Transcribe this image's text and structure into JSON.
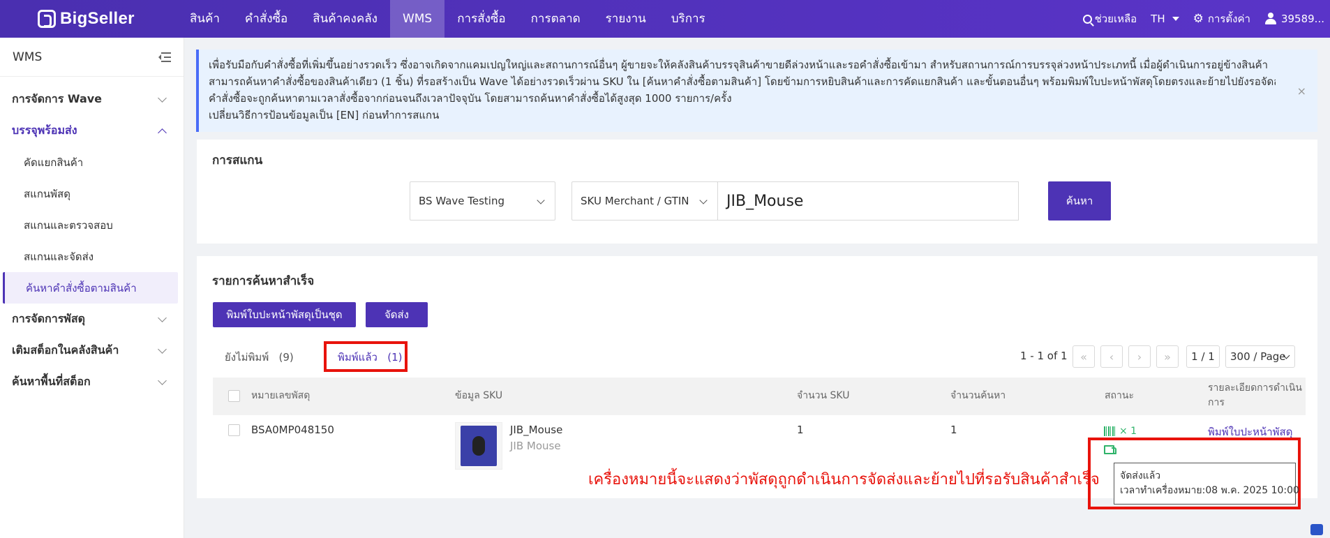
{
  "topnav": {
    "logo": "BigSeller",
    "items": [
      "สินค้า",
      "คำสั่งซื้อ",
      "สินค้าคงคลัง",
      "WMS",
      "การสั่งซื้อ",
      "การตลาด",
      "รายงาน",
      "บริการ"
    ],
    "active_index": 3,
    "help": "ช่วยเหลือ",
    "lang": "TH",
    "settings": "การตั้งค่า",
    "user": "39589..."
  },
  "sidebar": {
    "title": "WMS",
    "groups": [
      {
        "label": "การจัดการ Wave",
        "open": false
      },
      {
        "label": "บรรจุพร้อมส่ง",
        "open": true
      },
      {
        "label": "การจัดการพัสดุ",
        "open": false
      },
      {
        "label": "เติมสต็อกในคลังสินค้า",
        "open": false
      },
      {
        "label": "ค้นหาพื้นที่สต็อก",
        "open": false
      }
    ],
    "subitems": [
      "คัดแยกสินค้า",
      "สแกนพัสดุ",
      "สแกนและตรวจสอบ",
      "สแกนและจัดส่ง",
      "ค้นหาคำสั่งซื้อตามสินค้า"
    ],
    "active_sub": 4
  },
  "notice": {
    "lines": [
      "เพื่อรับมือกับคำสั่งซื้อที่เพิ่มขึ้นอย่างรวดเร็ว ซึ่งอาจเกิดจากแคมเปญใหญ่และสถานการณ์อื่นๆ ผู้ขายจะให้คลังสินค้าบรรจุสินค้าขายดีล่วงหน้าและรอคำสั่งซื้อเข้ามา สำหรับสถานการณ์การบรรจุล่วงหน้าประเภทนี้ เมื่อผู้ดำเนินการอยู่ข้างสินค้า",
      "สามารถค้นหาคำสั่งซื้อของสินค้าเดียว (1 ชิ้น) ที่รอสร้างเป็น Wave ได้อย่างรวดเร็วผ่าน SKU ใน [ค้นหาคำสั่งซื้อตามสินค้า] โดยข้ามการหยิบสินค้าและการคัดแยกสินค้า และขั้นตอนอื่นๆ พร้อมพิมพ์ใบปะหน้าพัสดุโดยตรงและย้ายไปยังรอจัดส่ง",
      "คำสั่งซื้อจะถูกค้นหาตามเวลาสั่งซื้อจากก่อนจนถึงเวลาปัจจุบัน โดยสามารถค้นหาคำสั่งซื้อได้สูงสุด 1000 รายการ/ครั้ง",
      "เปลี่ยนวิธีการป้อนข้อมูลเป็น [EN] ก่อนทำการสแกน"
    ],
    "close": "×"
  },
  "scan": {
    "title": "การสแกน",
    "wave_select": "BS Wave Testing",
    "type_select": "SKU Merchant / GTIN",
    "input_value": "JIB_Mouse",
    "search_button": "ค้นหา"
  },
  "results": {
    "title": "รายการค้นหาสำเร็จ",
    "btn_batch_print": "พิมพ์ใบปะหน้าพัสดุเป็นชุด",
    "btn_ship": "จัดส่ง",
    "tab_unprinted": "ยังไม่พิมพ์",
    "tab_unprinted_count": "(9)",
    "tab_printed": "พิมพ์แล้ว",
    "tab_printed_count": "(1)",
    "pagination": {
      "summary": "1 - 1 of 1",
      "page": "1 / 1",
      "page_size": "300 / Page"
    },
    "columns": [
      "หมายเลขพัสดุ",
      "ข้อมูล SKU",
      "จำนวน SKU",
      "จำนวนค้นหา",
      "สถานะ",
      "รายละเอียดการดำเนินการ"
    ],
    "rows": [
      {
        "tracking": "BSA0MP048150",
        "sku": "JIB_Mouse",
        "sku_name": "JIB Mouse",
        "sku_qty": "1",
        "search_qty": "1",
        "status_count": "× 1",
        "action": "พิมพ์ใบปะหน้าพัสดุ"
      }
    ]
  },
  "tooltip": {
    "line1": "จัดส่งแล้ว",
    "line2": "เวลาทำเครื่องหมาย:08 พ.ค. 2025 10:00"
  },
  "annotation": "เครื่องหมายนี้จะแสดงว่าพัสดุถูกดำเนินการจัดส่งและย้ายไปที่รอรับสินค้าสำเร็จ",
  "colors": {
    "brand": "#4d33b5",
    "topbar": "#5a34c8",
    "highlight": "#e8130c",
    "status_green": "#2fb36a"
  }
}
